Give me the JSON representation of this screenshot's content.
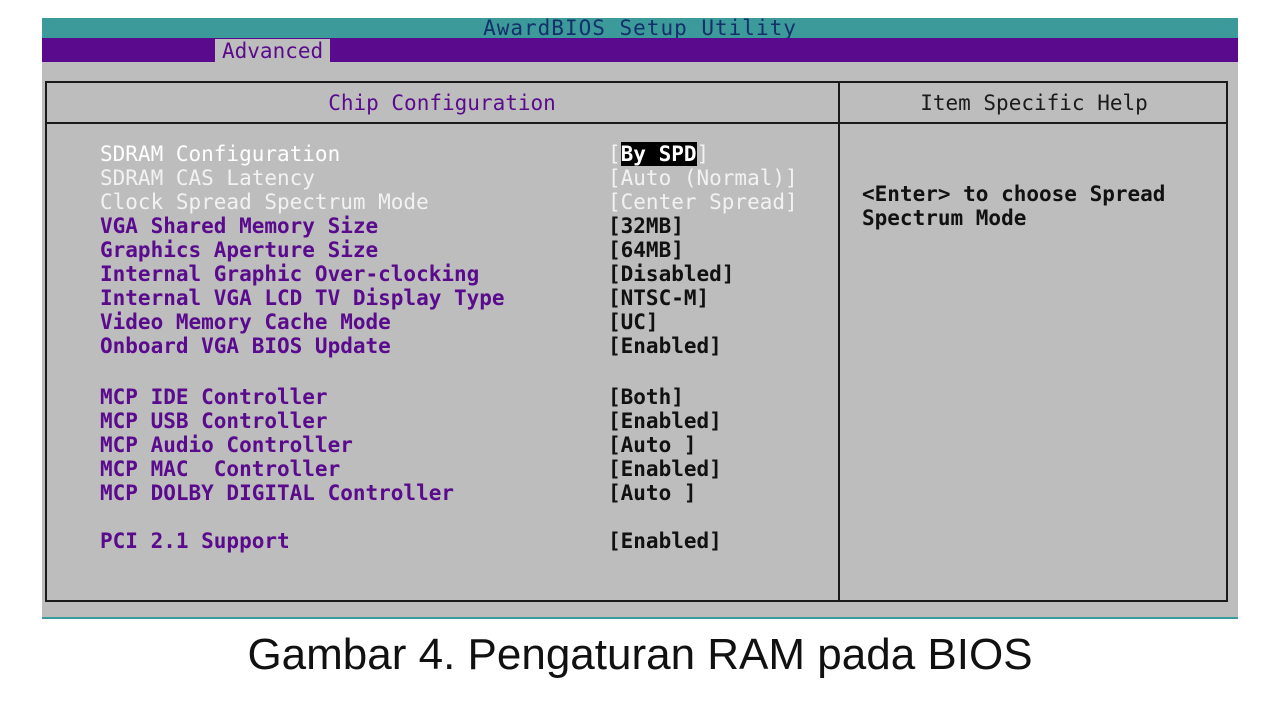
{
  "window": {
    "title": "AwardBIOS Setup Utility",
    "active_tab": "Advanced"
  },
  "panel": {
    "title": "Chip Configuration",
    "help_title": "Item Specific Help"
  },
  "settings": [
    {
      "name": "SDRAM Configuration",
      "value": "By SPD",
      "state": "selected"
    },
    {
      "name": "SDRAM CAS Latency",
      "value": "[Auto (Normal)]",
      "state": "disabled"
    },
    {
      "name": "Clock Spread Spectrum Mode",
      "value": "[Center Spread]",
      "state": "disabled"
    },
    {
      "name": "VGA Shared Memory Size",
      "value": "[32MB]",
      "state": "normal"
    },
    {
      "name": "Graphics Aperture Size",
      "value": "[64MB]",
      "state": "normal"
    },
    {
      "name": "Internal Graphic Over-clocking",
      "value": "[Disabled]",
      "state": "normal"
    },
    {
      "name": "Internal VGA LCD TV Display Type",
      "value": "[NTSC-M]",
      "state": "normal"
    },
    {
      "name": "Video Memory Cache Mode",
      "value": "[UC]",
      "state": "normal"
    },
    {
      "name": "Onboard VGA BIOS Update",
      "value": "[Enabled]",
      "state": "normal"
    },
    {
      "name": "MCP IDE Controller",
      "value": "[Both]",
      "state": "normal"
    },
    {
      "name": "MCP USB Controller",
      "value": "[Enabled]",
      "state": "normal"
    },
    {
      "name": "MCP Audio Controller",
      "value": "[Auto ]",
      "state": "normal"
    },
    {
      "name": "MCP MAC  Controller",
      "value": "[Enabled]",
      "state": "normal"
    },
    {
      "name": "MCP DOLBY DIGITAL Controller",
      "value": "[Auto ]",
      "state": "normal"
    },
    {
      "name": "PCI 2.1 Support",
      "value": "[Enabled]",
      "state": "normal"
    }
  ],
  "help": {
    "line1": "<Enter> to choose Spread",
    "line2": "Spectrum Mode"
  },
  "caption": "Gambar 4. Pengaturan RAM pada BIOS",
  "colors": {
    "title_bar": "#3d9a9a",
    "menu_bar": "#5a0a8c",
    "panel_bg": "#bdbdbd",
    "item_text": "#5a0a8c",
    "value_text": "#111111",
    "highlight": "#000000"
  }
}
